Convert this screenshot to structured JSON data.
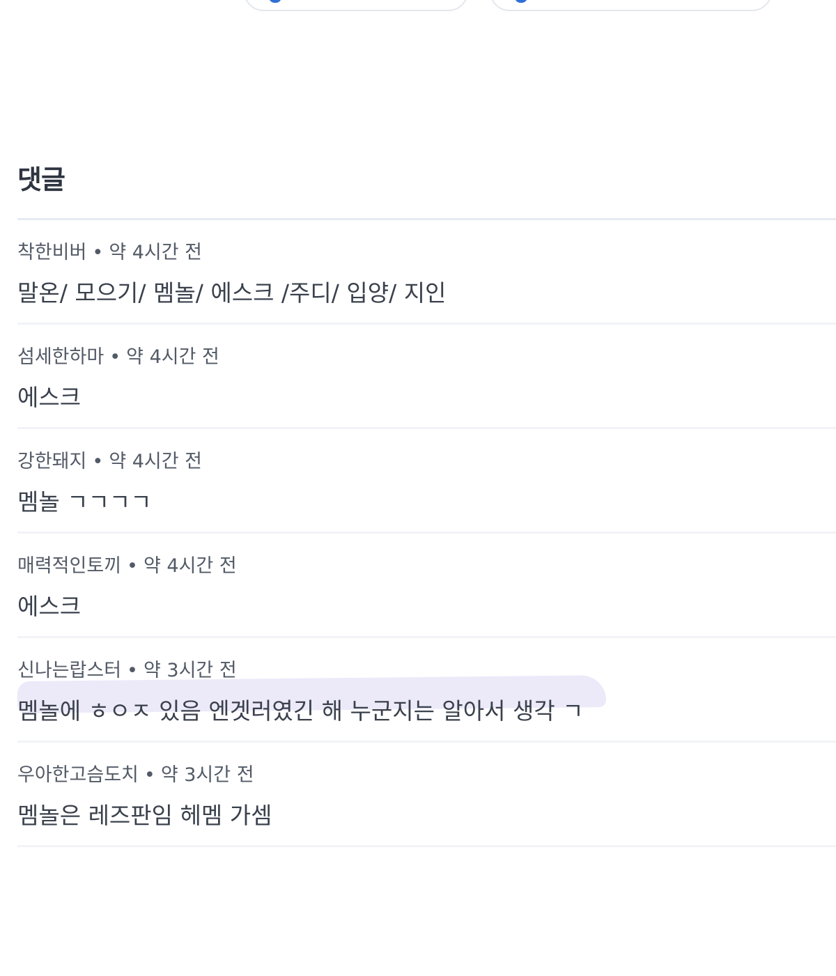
{
  "comments_section": {
    "title": "댓글",
    "comments": [
      {
        "author": "착한비버",
        "time": "약 4시간 전",
        "text": "말온/ 모으기/ 멤놀/ 에스크 /주디/ 입양/ 지인"
      },
      {
        "author": "섬세한하마",
        "time": "약 4시간 전",
        "text": "에스크"
      },
      {
        "author": "강한돼지",
        "time": "약 4시간 전",
        "text": "멤놀 ㄱㄱㄱㄱ"
      },
      {
        "author": "매력적인토끼",
        "time": "약 4시간 전",
        "text": "에스크"
      },
      {
        "author": "신나는랍스터",
        "time": "약 3시간 전",
        "text": "멤놀에 ㅎㅇㅈ 있음 엔겟러였긴 해 누군지는 알아서 생각 ㄱ"
      },
      {
        "author": "우아한고슴도치",
        "time": "약 3시간 전",
        "text": "멤놀은 레즈판임 헤멤 가셈"
      }
    ]
  },
  "colors": {
    "divider": "#e6ebf2",
    "highlight": "#c8c4ee",
    "accent": "#2f6fd6"
  }
}
